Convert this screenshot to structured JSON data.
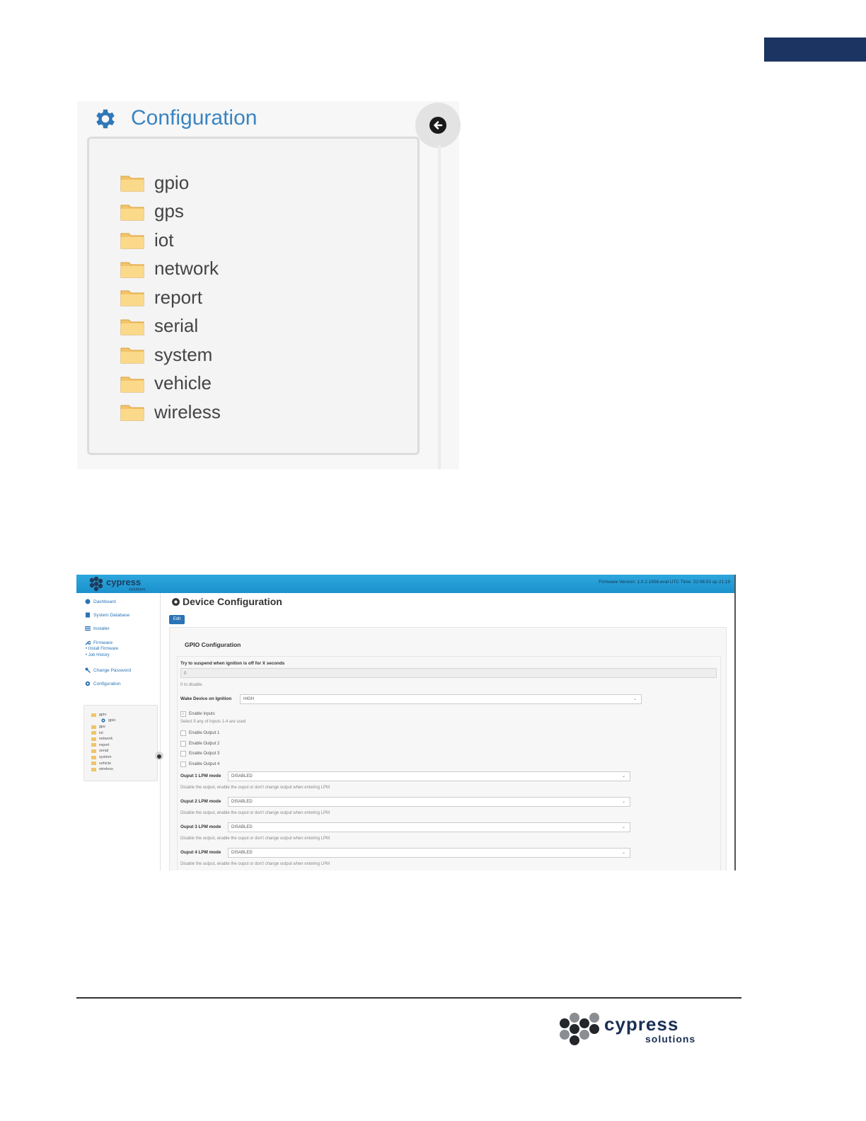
{
  "page": {
    "brand_color": "#1b3461",
    "accent_color": "#3a84c1"
  },
  "config_panel": {
    "title": "Configuration",
    "title_icon": "gear-icon",
    "back_icon": "arrow-left-circle-icon",
    "folders": [
      "gpio",
      "gps",
      "iot",
      "network",
      "report",
      "serial",
      "system",
      "vehicle",
      "wireless"
    ]
  },
  "device_screen": {
    "brand": "cypress",
    "brand_sub": "solutions",
    "firmware_text": "Firmware Version: 1.0.2.1656.eval   UTC Time: 22:08:53 up 21:19",
    "sidebar": {
      "items": [
        {
          "label": "Dashboard",
          "icon": "dashboard-icon"
        },
        {
          "label": "System Database",
          "icon": "database-icon"
        },
        {
          "label": "Installer",
          "icon": "list-icon"
        },
        {
          "label": "Firmware",
          "icon": "wrench-icon"
        },
        {
          "label": "Change Password",
          "icon": "key-icon"
        },
        {
          "label": "Configuration",
          "icon": "gear-icon"
        }
      ],
      "firmware_sub": [
        "Install Firmware",
        "Job History"
      ],
      "tree": {
        "root": "gpio",
        "child": "gpio",
        "folders": [
          "gps",
          "iot",
          "network",
          "report",
          "serial",
          "system",
          "vehicle",
          "wireless"
        ]
      }
    },
    "main": {
      "title": "Device Configuration",
      "edit_label": "Edit",
      "section_title": "GPIO Configuration",
      "suspend_label": "Try to suspend when ignition is off for X seconds",
      "suspend_value": "0",
      "suspend_help": "0 to disable",
      "wake_label": "Wake Device on Ignition",
      "wake_value": "HIGH",
      "enable_inputs_label": "Enable Inputs",
      "enable_inputs_help": "Select if any of inputs 1-4 are used",
      "outputs": [
        "Enable Output 1",
        "Enable Output 2",
        "Enable Output 3",
        "Enable Output 4"
      ],
      "lpm": [
        {
          "label": "Ouput 1 LPM mode",
          "value": "DISABLED",
          "help": "Disable the output, enable the ouput or don't change output when entering LPM"
        },
        {
          "label": "Ouput 2 LPM mode",
          "value": "DISABLED",
          "help": "Disable the output, enable the ouput or don't change output when entering LPM"
        },
        {
          "label": "Ouput 3 LPM mode",
          "value": "DISABLED",
          "help": "Disable the output, enable the ouput or don't change output when entering LPM"
        },
        {
          "label": "Ouput 4 LPM mode",
          "value": "DISABLED",
          "help": "Disable the output, enable the ouput or don't change output when entering LPM"
        }
      ]
    }
  },
  "footer": {
    "brand": "cypress",
    "brand_sub": "solutions"
  }
}
